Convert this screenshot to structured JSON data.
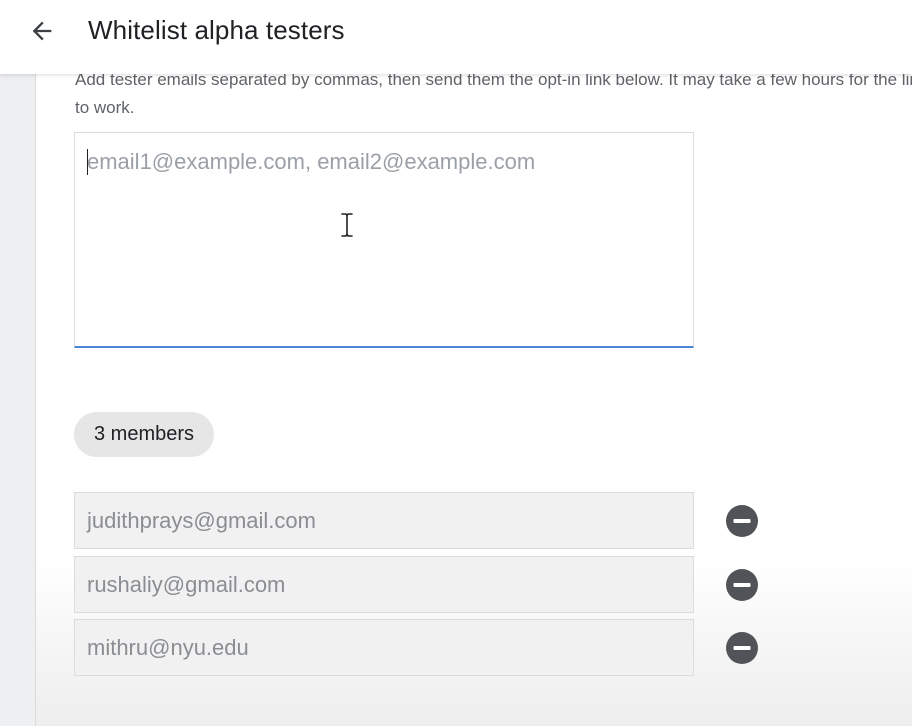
{
  "header": {
    "title": "Whitelist alpha testers",
    "back_icon": "arrow-back-icon"
  },
  "form": {
    "instructions": "Add tester emails separated by commas, then send them the opt-in link below. It may take a few hours for the link to work.",
    "emails_input": {
      "value": "",
      "placeholder": "email1@example.com, email2@example.com"
    }
  },
  "members": {
    "count_label": "3 members",
    "items": [
      {
        "email": "judithprays@gmail.com"
      },
      {
        "email": "rushaliy@gmail.com"
      },
      {
        "email": "mithru@nyu.edu"
      }
    ],
    "remove_icon": "remove-circle-icon"
  },
  "colors": {
    "accent": "#4a86d8",
    "remove_icon": "#505458",
    "chip_background": "#e6e6e6",
    "field_background": "#f1f1f1"
  }
}
